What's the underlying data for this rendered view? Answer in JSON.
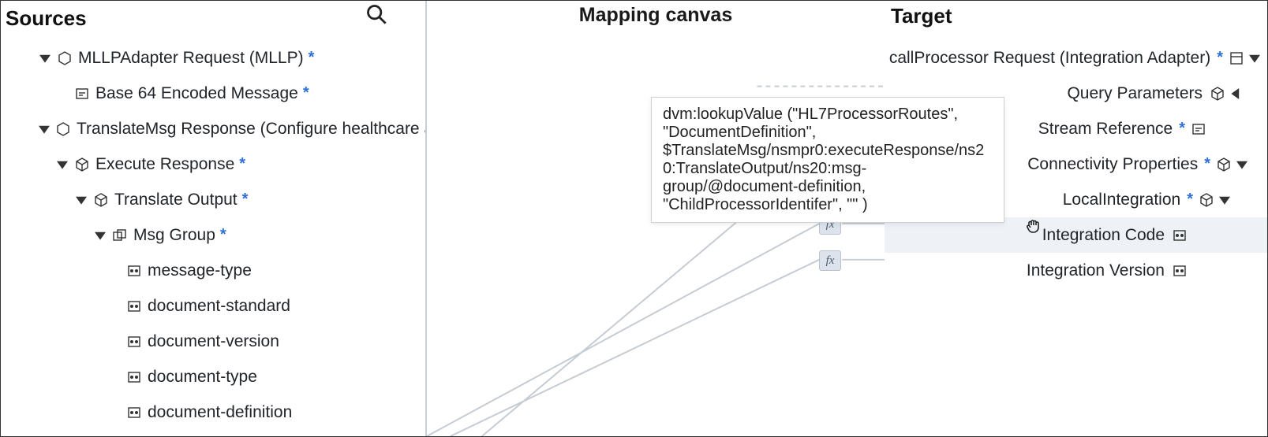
{
  "headers": {
    "sources": "Sources",
    "canvas": "Mapping canvas",
    "target": "Target"
  },
  "source_tree": {
    "mllp": "MLLPAdapter Request (MLLP)",
    "base64": "Base 64 Encoded Message",
    "translate": "TranslateMsg Response (Configure healthcare action )",
    "execute": "Execute Response",
    "output": "Translate Output",
    "msggroup": "Msg Group",
    "leaves": {
      "l1": "message-type",
      "l2": "document-standard",
      "l3": "document-version",
      "l4": "document-type",
      "l5": "document-definition"
    }
  },
  "tooltip": "dvm:lookupValue (\"HL7ProcessorRoutes\", \"DocumentDefinition\", $TranslateMsg/nsmpr0:executeResponse/ns20:TranslateOutput/ns20:msg-group/@document-definition, \"ChildProcessorIdentifer\", \"\" )",
  "fx": "fx",
  "target_tree": {
    "root": "callProcessor Request (Integration Adapter)",
    "query": "Query Parameters",
    "stream": "Stream Reference",
    "conn": "Connectivity Properties",
    "local": "LocalIntegration",
    "code": "Integration Code",
    "version": "Integration Version"
  }
}
